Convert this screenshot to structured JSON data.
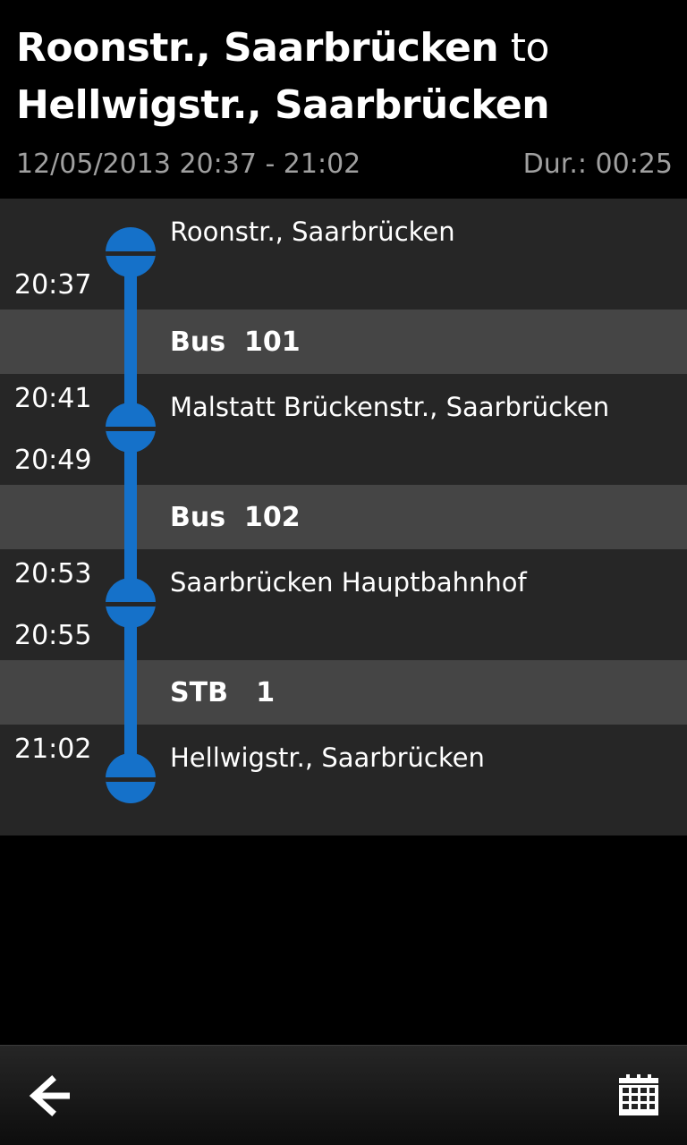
{
  "header": {
    "from": "Roonstr., Saarbrücken",
    "connector": "to",
    "to": "Hellwigstr., Saarbrücken",
    "date_time": "12/05/2013 20:37 - 21:02",
    "duration": "Dur.: 00:25"
  },
  "timeline": {
    "stops": [
      {
        "name": "Roonstr., Saarbrücken",
        "arrival": "",
        "departure": "20:37"
      },
      {
        "name": "Malstatt Brückenstr., Saarbrücken",
        "arrival": "20:41",
        "departure": "20:49"
      },
      {
        "name": "Saarbrücken Hauptbahnhof",
        "arrival": "20:53",
        "departure": "20:55"
      },
      {
        "name": "Hellwigstr., Saarbrücken",
        "arrival": "21:02",
        "departure": ""
      }
    ],
    "legs": [
      {
        "label": "Bus  101"
      },
      {
        "label": "Bus  102"
      },
      {
        "label": "STB   1"
      }
    ],
    "line_color": "#1571c9"
  },
  "toolbar": {
    "back_icon": "back-arrow-icon",
    "calendar_icon": "calendar-icon"
  }
}
